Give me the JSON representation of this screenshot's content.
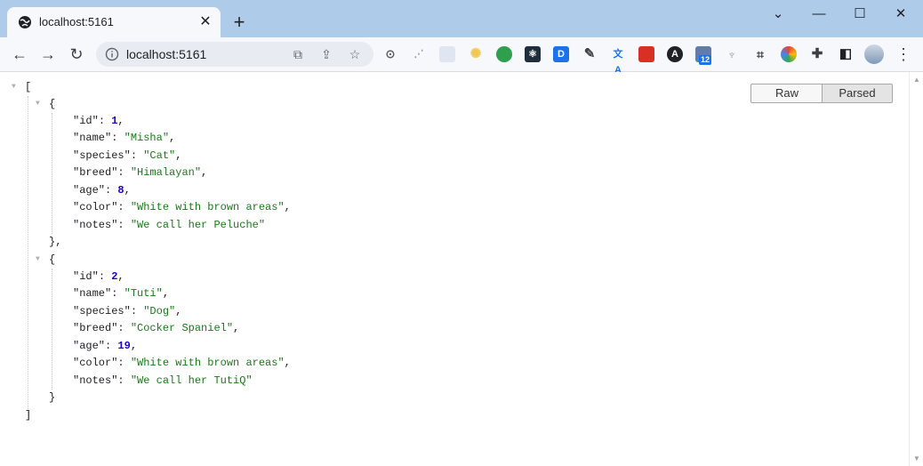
{
  "browser": {
    "tab_title": "localhost:5161",
    "tab_close": "✕",
    "new_tab": "+",
    "url": "localhost:5161",
    "window_controls": [
      "⌄",
      "—",
      "☐",
      "✕"
    ],
    "extension_badge": "12"
  },
  "viewer": {
    "raw_label": "Raw",
    "parsed_label": "Parsed"
  },
  "json": {
    "open_bracket": "[",
    "close_bracket": "]",
    "items": [
      {
        "id": "1",
        "name": "\"Misha\"",
        "species": "\"Cat\"",
        "breed": "\"Himalayan\"",
        "age": "8",
        "color": "\"White with brown areas\"",
        "notes": "\"We call her Peluche\""
      },
      {
        "id": "2",
        "name": "\"Tuti\"",
        "species": "\"Dog\"",
        "breed": "\"Cocker Spaniel\"",
        "age": "19",
        "color": "\"White with brown areas\"",
        "notes": "\"We call her TutiQ\""
      }
    ],
    "keys": {
      "id": "\"id\"",
      "name": "\"name\"",
      "species": "\"species\"",
      "breed": "\"breed\"",
      "age": "\"age\"",
      "color": "\"color\"",
      "notes": "\"notes\""
    }
  }
}
